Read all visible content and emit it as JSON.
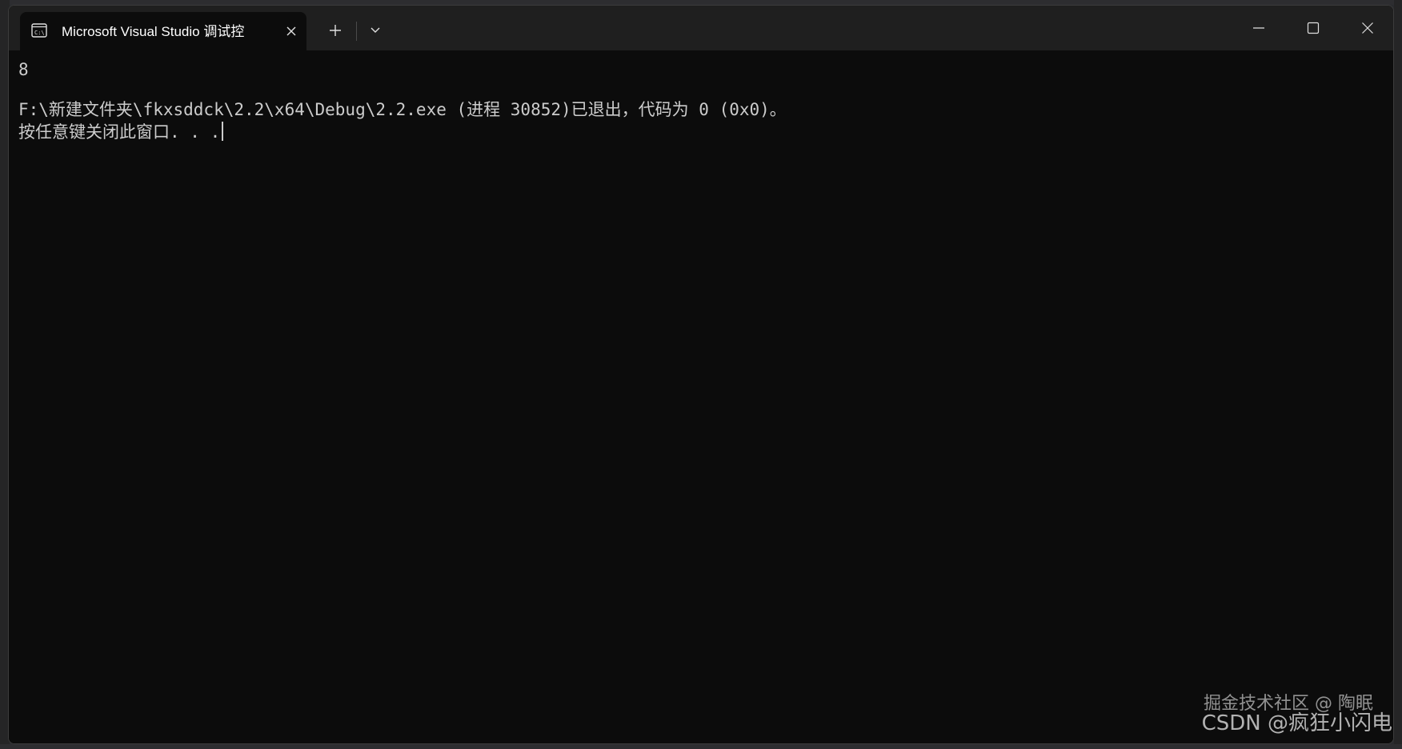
{
  "window": {
    "tab_title": "Microsoft Visual Studio 调试控",
    "tab_icon": "console-icon",
    "close_tab_icon": "close-icon",
    "new_tab_icon": "plus-icon",
    "dropdown_icon": "chevron-down-icon",
    "minimize_icon": "minimize-icon",
    "maximize_icon": "maximize-icon",
    "close_window_icon": "close-icon"
  },
  "console": {
    "output_line_1": "8",
    "output_line_3": "F:\\新建文件夹\\fkxsddck\\2.2\\x64\\Debug\\2.2.exe (进程 30852)已退出，代码为 0 (0x0)。",
    "output_line_4": "按任意键关闭此窗口. . ."
  },
  "watermark": {
    "line_1": "掘金技术社区 @ 陶眠",
    "line_2": "CSDN @疯狂小闪电"
  },
  "colors": {
    "console_bg": "#0c0c0c",
    "titlebar_bg": "#1f1f1f",
    "text": "#cccccc"
  }
}
